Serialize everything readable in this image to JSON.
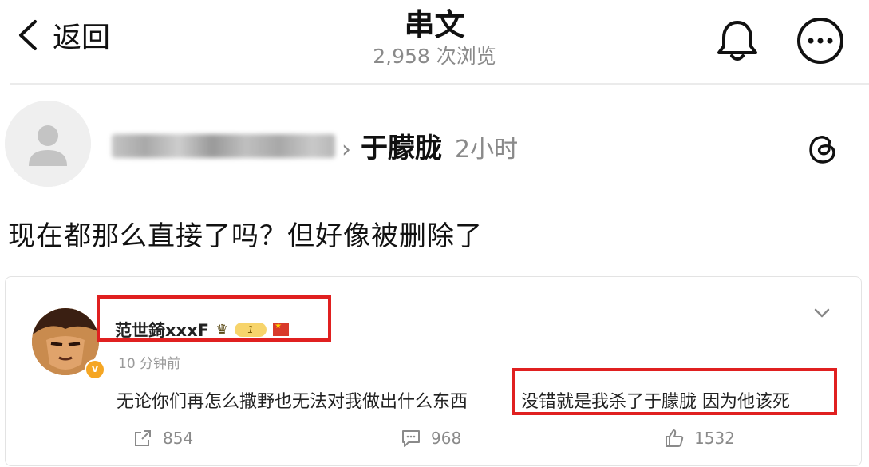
{
  "header": {
    "back_label": "返回",
    "title": "串文",
    "views": "2,958 次浏览"
  },
  "post": {
    "author_blurred": true,
    "separator": "›",
    "target_user": "于朦胧",
    "time": "2小时",
    "text": "现在都那么直接了吗？但好像被删除了"
  },
  "embedded_comment": {
    "username": "范世錡xxxF",
    "level_badge": "1",
    "time": "10 分钟前",
    "text_part1": "无论你们再怎么撒野也无法对我做出什么东西",
    "text_part2": "没错就是我杀了于朦胧 因为他该死",
    "verified_badge": "v",
    "actions": {
      "repost_count": "854",
      "comment_count": "968",
      "like_count": "1532"
    }
  },
  "icons": {
    "back": "chevron-left-icon",
    "bell": "bell-icon",
    "more": "more-icon",
    "threads": "threads-icon",
    "card_chevron": "chevron-down-icon",
    "repost": "repost-icon",
    "comment": "comment-icon",
    "like": "thumbs-up-icon"
  },
  "colors": {
    "highlight_box": "#e02020",
    "muted_text": "#8a8a8a",
    "verified": "#f5a623"
  }
}
